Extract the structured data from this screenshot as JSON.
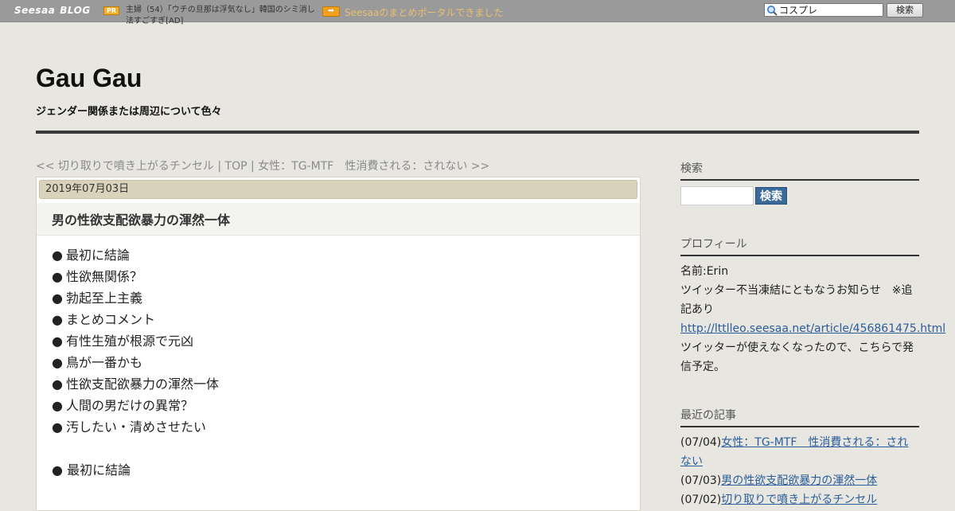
{
  "topbar": {
    "brand_a": "Seesaa",
    "brand_b": "BLOG",
    "pr_badge": "PR",
    "pr_text": "主婦（54）「ウチの旦那は浮気なし」韓国のシミ消し法すごすぎ[AD]",
    "arrow_badge": "➡",
    "portal_link": "Seesaaのまとめポータルできました",
    "search_value": "コスプレ",
    "search_button": "検索"
  },
  "header": {
    "title": "Gau Gau",
    "description": "ジェンダー関係または周辺について色々"
  },
  "article_nav": {
    "prev": "<< 切り取りで噴き上がるチンセル",
    "sep1": " | ",
    "top": "TOP",
    "sep2": " | ",
    "next": "女性：TG-MTF　性消費される：されない >>"
  },
  "post": {
    "date": "2019年07月03日",
    "title": "男の性欲支配欲暴力の渾然一体",
    "bullet": "●",
    "toc": [
      "最初に結論",
      "性欲無関係？",
      "勃起至上主義",
      "まとめコメント",
      "有性生殖が根源で元凶",
      "鳥が一番かも",
      "性欲支配欲暴力の渾然一体",
      "人間の男だけの異常？",
      "汚したい・清めさせたい"
    ],
    "section_first": "最初に結論"
  },
  "sidebar": {
    "search_heading": "検索",
    "search_button": "検索",
    "profile_heading": "プロフィール",
    "profile_name": "名前:Erin",
    "profile_notice": "ツイッター不当凍結にともなうお知らせ　※追記あり",
    "profile_link": "http://lttlleo.seesaa.net/article/456861475.html",
    "profile_note": "ツイッターが使えなくなったので、こちらで発信予定。",
    "recent_heading": "最近の記事",
    "recent": [
      {
        "date": "(07/04)",
        "title": "女性：TG-MTF　性消費される：されない"
      },
      {
        "date": "(07/03)",
        "title": "男の性欲支配欲暴力の渾然一体"
      },
      {
        "date": "(07/02)",
        "title": "切り取りで噴き上がるチンセル"
      }
    ]
  },
  "colors": {
    "background": "#e8e6e0",
    "topbar": "#9a9a9a",
    "date_bar": "#dad3bb",
    "link": "#2a5d9a",
    "search_button": "#3a6a9a"
  }
}
